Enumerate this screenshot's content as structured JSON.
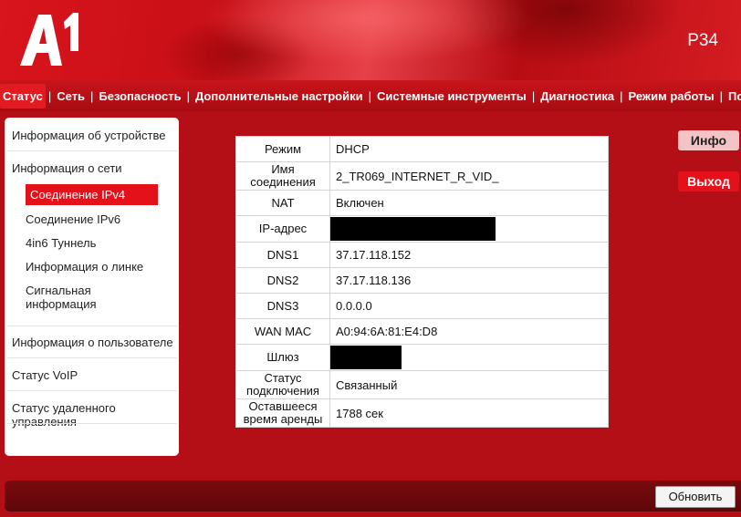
{
  "brand": {
    "logo_text": "A1",
    "model": "P34"
  },
  "nav": {
    "items": [
      "Статус",
      "Сеть",
      "Безопасность",
      "Дополнительные настройки",
      "Системные инструменты",
      "Диагностика",
      "Режим работы",
      "Помощь"
    ],
    "separator": "|"
  },
  "sidebar": {
    "device_info": "Информация об устройстве",
    "network_info": "Информация о сети",
    "sub_items": [
      "Соединение IPv4",
      "Соединение IPv6",
      "4in6 Туннель",
      "Информация о линке",
      "Сигнальная информация"
    ],
    "user_info": "Информация о пользователе",
    "voip_status": "Статус VoIP",
    "remote_status": "Статус удаленного управления"
  },
  "connection": {
    "rows": [
      {
        "label": "Режим",
        "value": "DHCP"
      },
      {
        "label": "Имя соединения",
        "value": "2_TR069_INTERNET_R_VID_"
      },
      {
        "label": "NAT",
        "value": "Включен"
      },
      {
        "label": "IP-адрес",
        "value": ""
      },
      {
        "label": "DNS1",
        "value": "37.17.118.152"
      },
      {
        "label": "DNS2",
        "value": "37.17.118.136"
      },
      {
        "label": "DNS3",
        "value": "0.0.0.0"
      },
      {
        "label": "WAN MAC",
        "value": "A0:94:6A:81:E4:D8"
      },
      {
        "label": "Шлюз",
        "value": ""
      },
      {
        "label": "Статус подключения",
        "value": "Связанный"
      },
      {
        "label": "Оставшееся время аренды",
        "value": "1788 сек"
      }
    ]
  },
  "actions": {
    "info": "Инфо",
    "exit": "Выход",
    "refresh": "Обновить"
  },
  "colors": {
    "brand_red": "#e4111a",
    "dark_red": "#b40f16"
  }
}
